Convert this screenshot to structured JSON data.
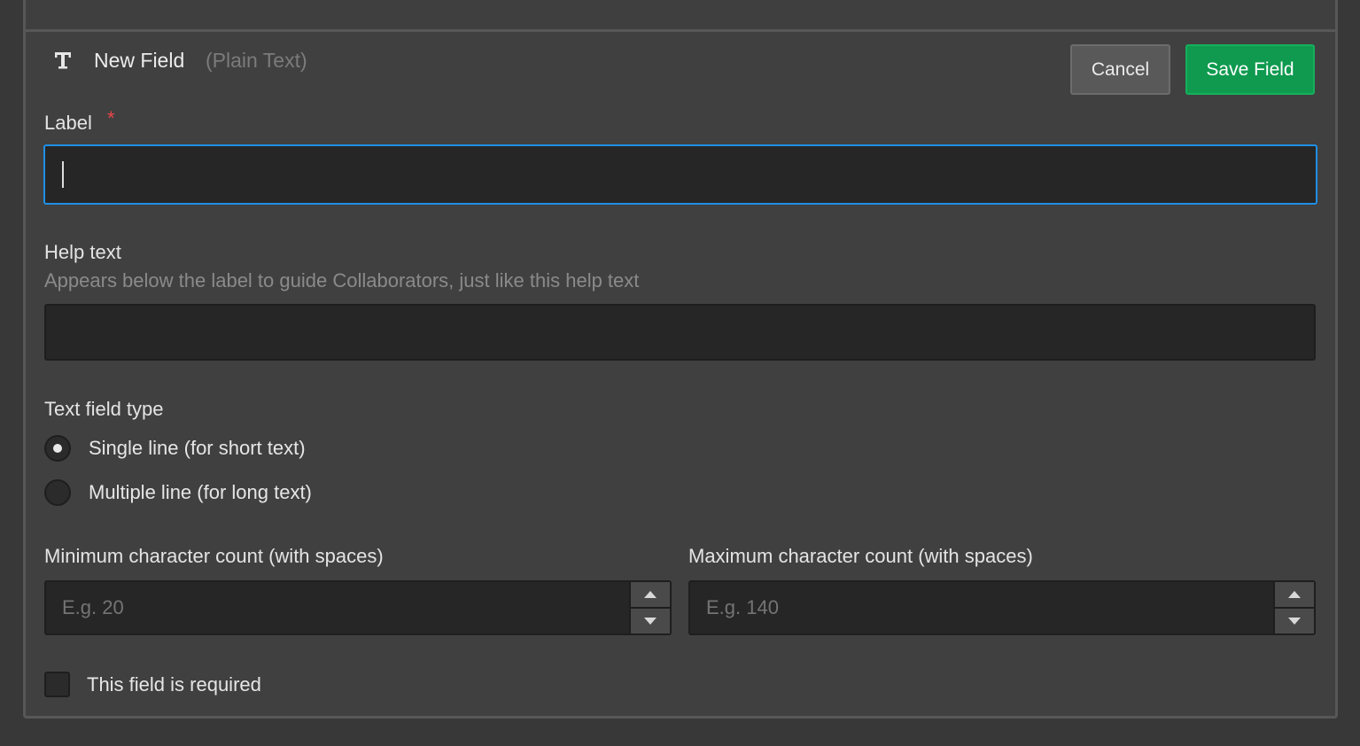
{
  "header": {
    "title": "New Field",
    "subtitle": "(Plain Text)",
    "icon": "text-type-icon"
  },
  "actions": {
    "cancel_label": "Cancel",
    "save_label": "Save Field"
  },
  "colors": {
    "accent_focus": "#1f8fe6",
    "save_button": "#0f9a4f",
    "required_star": "#e8474a"
  },
  "form": {
    "label": {
      "title": "Label",
      "required_mark": "*",
      "value": ""
    },
    "help_text": {
      "title": "Help text",
      "hint": "Appears below the label to guide Collaborators, just like this help text",
      "value": ""
    },
    "text_type": {
      "title": "Text field type",
      "options": [
        {
          "label": "Single line (for short text)",
          "selected": true
        },
        {
          "label": "Multiple line (for long text)",
          "selected": false
        }
      ]
    },
    "min_count": {
      "title": "Minimum character count (with spaces)",
      "placeholder": "E.g. 20"
    },
    "max_count": {
      "title": "Maximum character count (with spaces)",
      "placeholder": "E.g. 140"
    },
    "required": {
      "label": "This field is required",
      "checked": false
    }
  }
}
